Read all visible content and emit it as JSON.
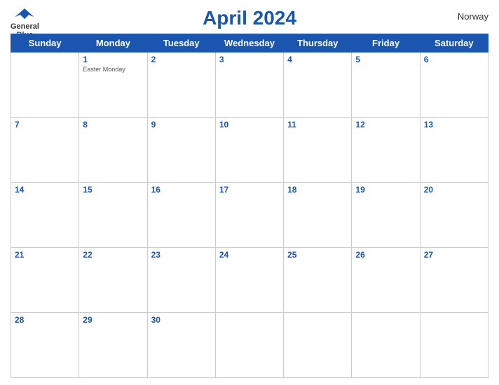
{
  "header": {
    "title": "April 2024",
    "country": "Norway",
    "logo": {
      "general": "General",
      "blue": "Blue"
    }
  },
  "weekdays": [
    "Sunday",
    "Monday",
    "Tuesday",
    "Wednesday",
    "Thursday",
    "Friday",
    "Saturday"
  ],
  "weeks": [
    [
      {
        "day": null,
        "empty": true
      },
      {
        "day": 1,
        "holiday": "Easter Monday"
      },
      {
        "day": 2
      },
      {
        "day": 3
      },
      {
        "day": 4
      },
      {
        "day": 5
      },
      {
        "day": 6
      }
    ],
    [
      {
        "day": 7
      },
      {
        "day": 8
      },
      {
        "day": 9
      },
      {
        "day": 10
      },
      {
        "day": 11
      },
      {
        "day": 12
      },
      {
        "day": 13
      }
    ],
    [
      {
        "day": 14
      },
      {
        "day": 15
      },
      {
        "day": 16
      },
      {
        "day": 17
      },
      {
        "day": 18
      },
      {
        "day": 19
      },
      {
        "day": 20
      }
    ],
    [
      {
        "day": 21
      },
      {
        "day": 22
      },
      {
        "day": 23
      },
      {
        "day": 24
      },
      {
        "day": 25
      },
      {
        "day": 26
      },
      {
        "day": 27
      }
    ],
    [
      {
        "day": 28
      },
      {
        "day": 29
      },
      {
        "day": 30
      },
      {
        "day": null,
        "empty": true
      },
      {
        "day": null,
        "empty": true
      },
      {
        "day": null,
        "empty": true
      },
      {
        "day": null,
        "empty": true
      }
    ]
  ]
}
